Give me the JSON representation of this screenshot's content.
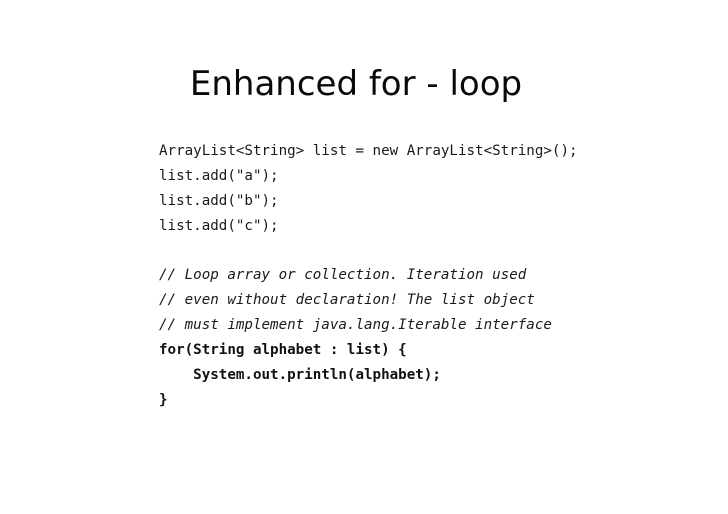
{
  "slide": {
    "title": "Enhanced for - loop",
    "code_block_1": [
      "ArrayList<String> list = new ArrayList<String>();",
      "list.add(\"a\");",
      "list.add(\"b\");",
      "list.add(\"c\");"
    ],
    "comments": [
      "// Loop array or collection. Iteration used",
      "// even without declaration! The list object",
      "// must implement java.lang.Iterable interface"
    ],
    "loop_code": [
      "for(String alphabet : list) {",
      "    System.out.println(alphabet);",
      "}"
    ]
  }
}
